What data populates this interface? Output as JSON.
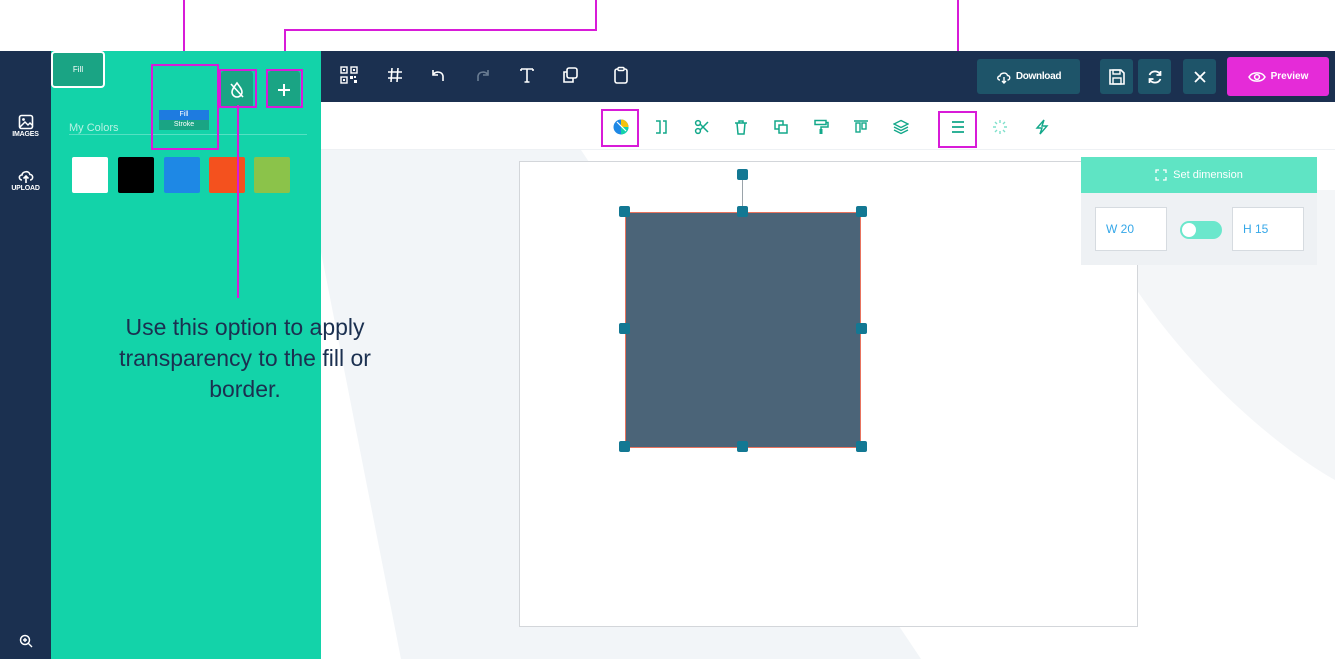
{
  "panel": {
    "fill_label": "Fill",
    "fill_options": [
      "Fill",
      "Stroke"
    ],
    "my_colors_label": "My Colors",
    "swatches": [
      "#ffffff",
      "#000000",
      "#1e88e5",
      "#f4511e",
      "#8bc34a"
    ]
  },
  "rail": {
    "images_label": "IMAGES",
    "upload_label": "UPLOAD"
  },
  "topbar": {
    "download_label": "Download",
    "preview_label": "Preview"
  },
  "dimension": {
    "title": "Set dimension",
    "width_value": "W 20",
    "height_value": "H 15"
  },
  "annotation": {
    "text": "Use this option to apply transparency to the fill or border."
  },
  "colors": {
    "rail_bg": "#1b3050",
    "panel_bg": "#13d3a9",
    "accent": "#e52bd8",
    "shape_fill": "#4b6478",
    "shape_stroke": "#e8735e",
    "handle": "#137893"
  }
}
